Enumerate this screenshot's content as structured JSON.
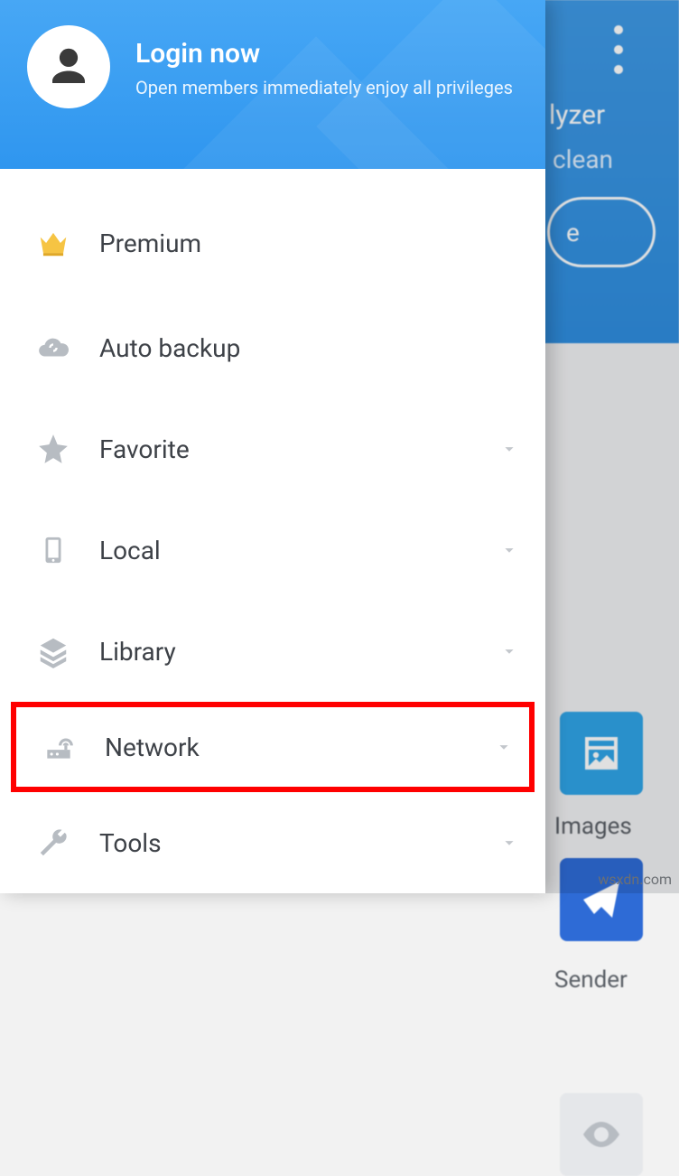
{
  "header": {
    "title": "Login now",
    "subtitle": "Open members immediately enjoy all privileges"
  },
  "menu": {
    "items": [
      {
        "id": "premium",
        "label": "Premium",
        "expandable": false
      },
      {
        "id": "autobackup",
        "label": "Auto backup",
        "expandable": false
      },
      {
        "id": "favorite",
        "label": "Favorite",
        "expandable": true
      },
      {
        "id": "local",
        "label": "Local",
        "expandable": true
      },
      {
        "id": "library",
        "label": "Library",
        "expandable": true
      },
      {
        "id": "network",
        "label": "Network",
        "expandable": true,
        "highlighted": true
      },
      {
        "id": "tools",
        "label": "Tools",
        "expandable": true
      }
    ]
  },
  "background": {
    "title_fragment": "lyzer",
    "subtitle_fragment": "clean",
    "pill_fragment": "e",
    "tiles": {
      "images_label": "Images",
      "sender_label": "Sender"
    }
  },
  "watermark": "wsxdn.com"
}
